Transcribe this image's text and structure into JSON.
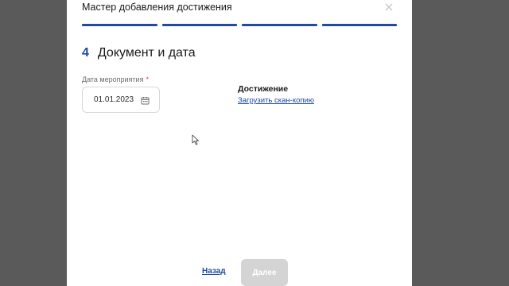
{
  "modal": {
    "title": "Мастер добавления достижения",
    "close_icon": "close-icon",
    "steps_total": 4,
    "steps_completed": 4
  },
  "step": {
    "number": "4",
    "title": "Документ и дата"
  },
  "date_field": {
    "label": "Дата мероприятия",
    "required_mark": "*",
    "value": "01.01.2023",
    "icon": "calendar-icon"
  },
  "achievement": {
    "title": "Достижение",
    "upload_link": "Загрузить скан-копию"
  },
  "footer": {
    "back_label": "Назад",
    "next_label": "Далее",
    "next_disabled": true
  },
  "colors": {
    "accent": "#1f4aa8",
    "overlay": "#5a5a5a",
    "disabled_button": "#d4d4d4"
  }
}
